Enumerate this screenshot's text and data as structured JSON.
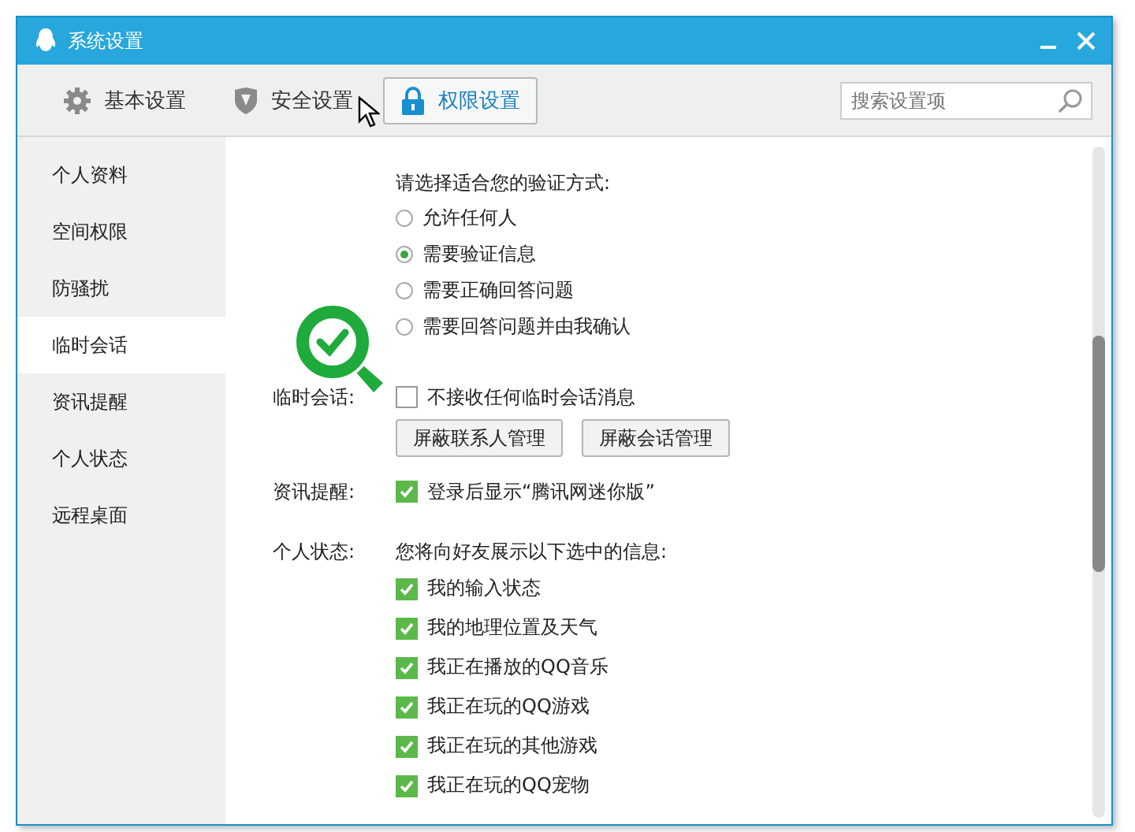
{
  "window": {
    "title": "系统设置"
  },
  "toolbar": {
    "tabs": [
      {
        "label": "基本设置",
        "kind": "gear",
        "selected": false
      },
      {
        "label": "安全设置",
        "kind": "shield",
        "selected": false
      },
      {
        "label": "权限设置",
        "kind": "lock",
        "selected": true
      }
    ]
  },
  "search": {
    "placeholder": "搜索设置项"
  },
  "sidebar": {
    "items": [
      {
        "label": "个人资料",
        "selected": false
      },
      {
        "label": "空间权限",
        "selected": false
      },
      {
        "label": "防骚扰",
        "selected": false
      },
      {
        "label": "临时会话",
        "selected": true
      },
      {
        "label": "资讯提醒",
        "selected": false
      },
      {
        "label": "个人状态",
        "selected": false
      },
      {
        "label": "远程桌面",
        "selected": false
      }
    ]
  },
  "verification": {
    "prompt": "请选择适合您的验证方式:",
    "options": [
      {
        "label": "允许任何人",
        "selected": false
      },
      {
        "label": "需要验证信息",
        "selected": true
      },
      {
        "label": "需要正确回答问题",
        "selected": false
      },
      {
        "label": "需要回答问题并由我确认",
        "selected": false
      }
    ]
  },
  "temp_session": {
    "label": "临时会话:",
    "checkbox": {
      "label": "不接收任何临时会话消息",
      "checked": false
    },
    "buttons": [
      "屏蔽联系人管理",
      "屏蔽会话管理"
    ]
  },
  "news": {
    "label": "资讯提醒:",
    "checkbox": {
      "label": "登录后显示“腾讯网迷你版”",
      "checked": true
    }
  },
  "status": {
    "label": "个人状态:",
    "prompt": "您将向好友展示以下选中的信息:",
    "items": [
      {
        "label": "我的输入状态",
        "checked": true
      },
      {
        "label": "我的地理位置及天气",
        "checked": true
      },
      {
        "label": "我正在播放的QQ音乐",
        "checked": true
      },
      {
        "label": "我正在玩的QQ游戏",
        "checked": true
      },
      {
        "label": "我正在玩的其他游戏",
        "checked": true
      },
      {
        "label": "我正在玩的QQ宠物",
        "checked": true
      }
    ]
  }
}
